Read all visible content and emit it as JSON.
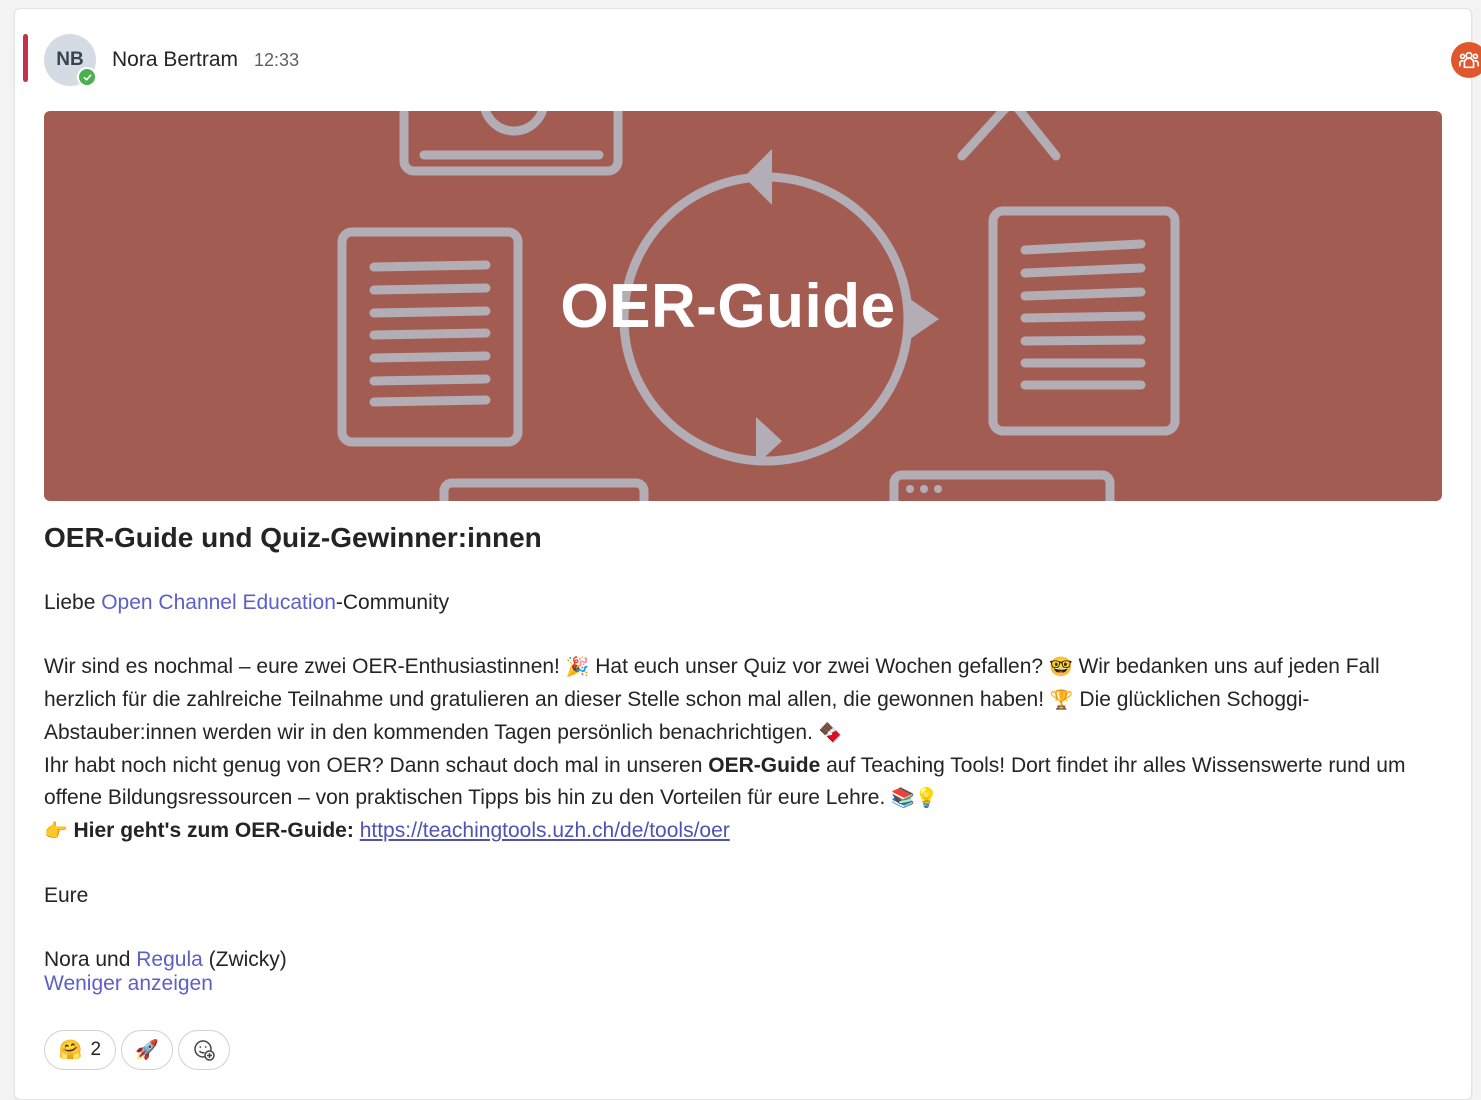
{
  "message": {
    "author_initials": "NB",
    "author": "Nora Bertram",
    "time": "12:33"
  },
  "banner": {
    "text": "OER-Guide"
  },
  "post": {
    "title": "OER-Guide und Quiz-Gewinner:innen",
    "greeting_pre": "Liebe ",
    "greeting_mention": "Open Channel Education",
    "greeting_post": "-Community",
    "p1_a": "Wir sind es nochmal – eure zwei OER-Enthusiastinnen! ",
    "p1_emoji1": "🎉",
    "p1_b": " Hat euch unser Quiz vor zwei Wochen gefallen? ",
    "p1_emoji2": "🤓",
    "p1_c": " Wir bedanken uns auf jeden Fall herzlich für die zahlreiche Teilnahme und gratulieren an dieser Stelle schon mal allen, die gewonnen haben! ",
    "p1_emoji3": "🏆",
    "p1_d": " Die glücklichen Schoggi-Abstauber:innen werden wir in den kommenden Tagen persönlich benachrichtigen. ",
    "p1_emoji4": "🍫",
    "p2_a": "Ihr habt noch nicht genug von OER? Dann schaut doch mal in unseren ",
    "p2_bold": "OER-Guide",
    "p2_b": " auf Teaching Tools! Dort findet ihr alles Wissenswerte rund um offene Bildungsressourcen – von praktischen Tipps bis hin zu den Vorteilen für eure Lehre. ",
    "p2_emoji": "📚💡",
    "p3_emoji": "👉",
    "p3_bold": " Hier geht's zum OER-Guide: ",
    "p3_link": "https://teachingtools.uzh.ch/de/tools/oer",
    "sign1": "Eure",
    "sign2_a": "Nora und ",
    "sign2_mention": "Regula",
    "sign2_b": " (Zwicky)",
    "show_less": "Weniger anzeigen"
  },
  "reactions": [
    {
      "emoji": "🤗",
      "count": "2"
    },
    {
      "emoji": "🚀",
      "count": ""
    }
  ],
  "colors": {
    "accent": "#c4314b",
    "banner": "#a35c52",
    "link": "#5b5fc7",
    "presence": "#4caf50"
  }
}
